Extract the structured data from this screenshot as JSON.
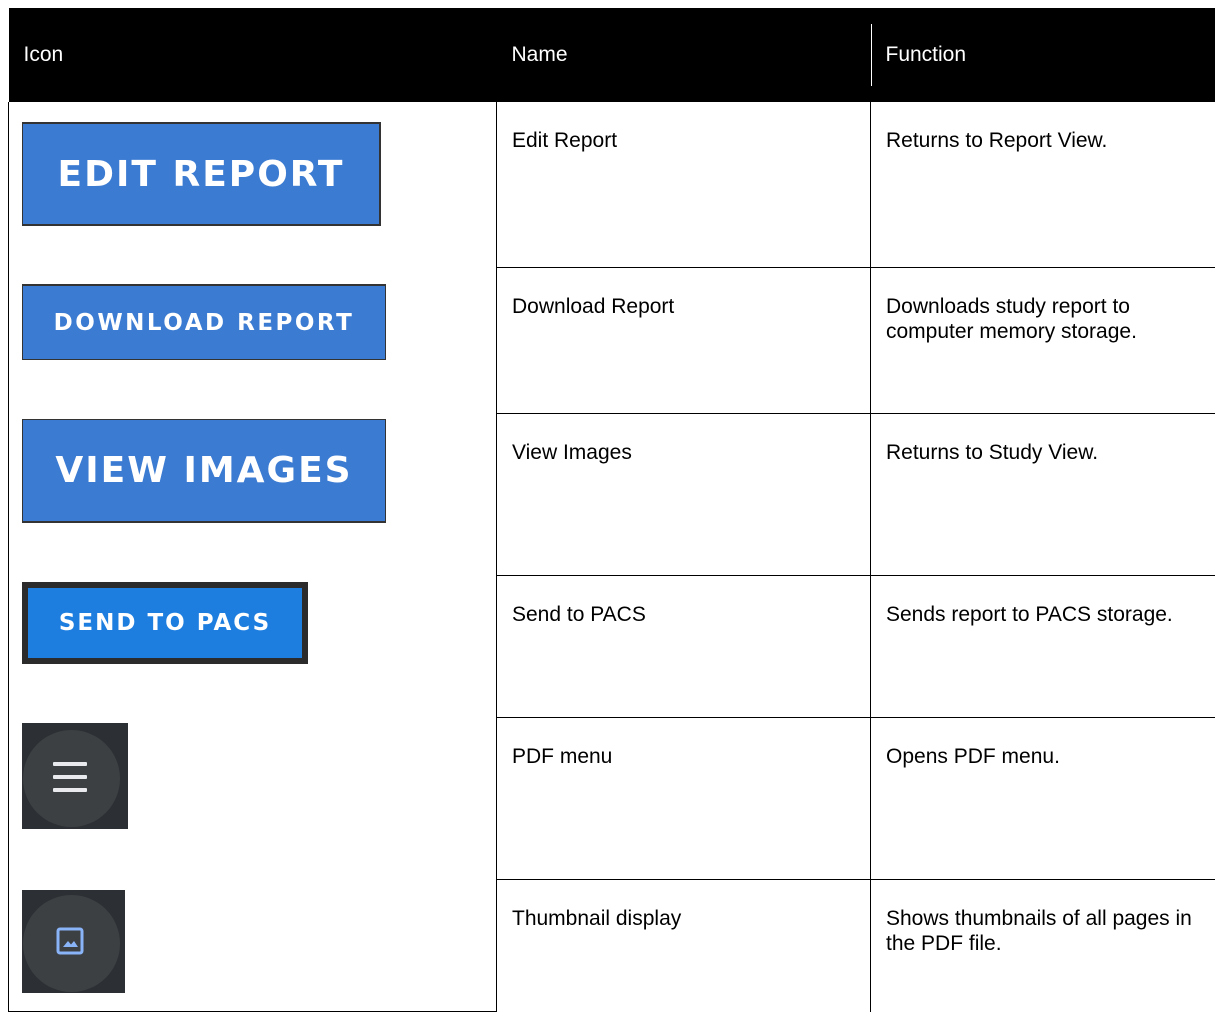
{
  "table": {
    "headers": [
      "Icon",
      "Name",
      "Function"
    ],
    "rows": [
      {
        "icon_label": "EDIT REPORT",
        "name": "Edit Report",
        "function": "Returns to Report View."
      },
      {
        "icon_label": "DOWNLOAD REPORT",
        "name": "Download Report",
        "function": "Downloads study report to computer memory storage."
      },
      {
        "icon_label": "VIEW IMAGES",
        "name": "View Images",
        "function": "Returns to Study View."
      },
      {
        "icon_label": "SEND TO PACS",
        "name": "Send to PACS",
        "function": "Sends report to PACS storage."
      },
      {
        "icon": "menu-icon",
        "name": "PDF menu",
        "function": "Opens PDF menu."
      },
      {
        "icon": "image-icon",
        "name": "Thumbnail display",
        "function": "Shows thumbnails of all pages in the PDF file."
      }
    ]
  },
  "colors": {
    "header_bg": "#000000",
    "button_blue": "#3b7bd2",
    "pacs_blue": "#1d7ee0",
    "dark_tile": "#2c2f33",
    "tile_circle": "#3c4043",
    "image_icon": "#8ab4f8"
  }
}
